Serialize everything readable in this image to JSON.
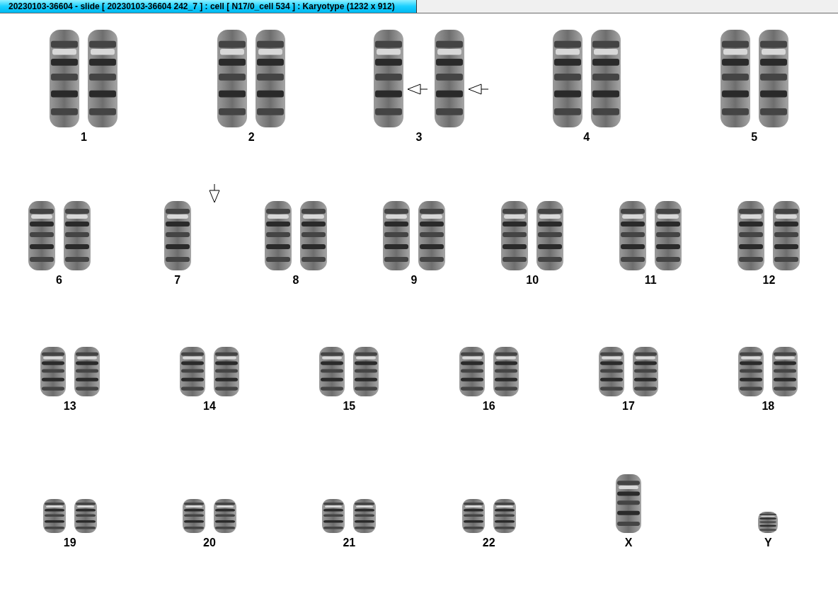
{
  "window": {
    "title": "20230103-36604 - slide [ 20230103-36604 242_7 ] : cell [ N17/0_cell 534 ] : Karyotype  (1232 x 912)"
  },
  "rows": [
    {
      "pairs": [
        {
          "label": "1"
        },
        {
          "label": "2"
        },
        {
          "label": "3",
          "arrow_beside": true
        },
        {
          "label": "4"
        },
        {
          "label": "5"
        }
      ]
    },
    {
      "pairs": [
        {
          "label": "6"
        },
        {
          "label": "7",
          "single": true,
          "arrow_above": true
        },
        {
          "label": "8"
        },
        {
          "label": "9"
        },
        {
          "label": "10"
        },
        {
          "label": "11"
        },
        {
          "label": "12"
        }
      ]
    },
    {
      "pairs": [
        {
          "label": "13"
        },
        {
          "label": "14"
        },
        {
          "label": "15"
        },
        {
          "label": "16"
        },
        {
          "label": "17"
        },
        {
          "label": "18"
        }
      ]
    },
    {
      "pairs": [
        {
          "label": "19"
        },
        {
          "label": "20"
        },
        {
          "label": "21"
        },
        {
          "label": "22"
        },
        {
          "label": "X",
          "single": true
        },
        {
          "label": "Y",
          "single": true
        }
      ]
    }
  ]
}
